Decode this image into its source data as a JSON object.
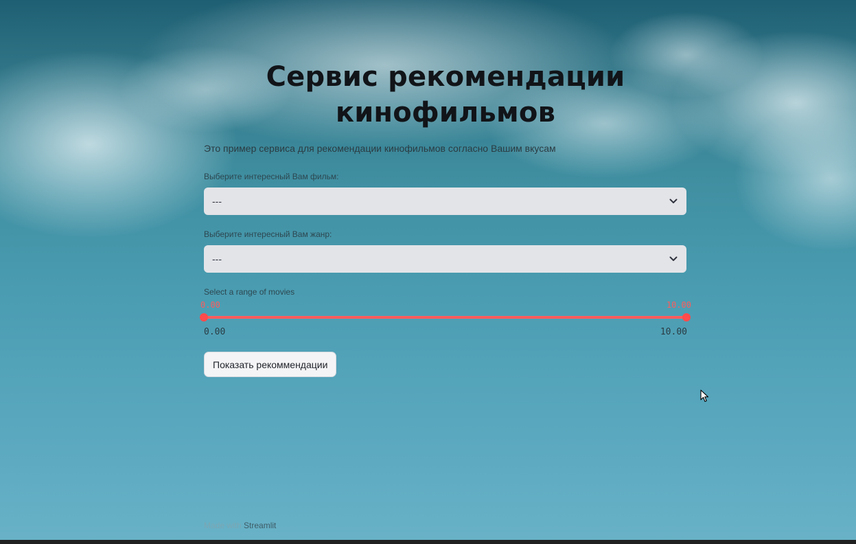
{
  "header": {
    "title_line1": "Сервис рекомендации",
    "title_line2": "кинофильмов",
    "subtitle": "Это пример сервиса для рекомендации кинофильмов согласно Вашим вкусам"
  },
  "form": {
    "film_label": "Выберите интересный Вам фильм:",
    "film_value": "---",
    "genre_label": "Выберите интересный Вам жанр:",
    "genre_value": "---",
    "range_label": "Select a range of movies",
    "range_min_value": "0.00",
    "range_max_value": "10.00",
    "range_min_tick": "0.00",
    "range_max_tick": "10.00",
    "range_selected": [
      0.0,
      10.0
    ],
    "submit_label": "Показать рекоммендации"
  },
  "footer": {
    "made_with": "Made with",
    "brand": "Streamlit"
  },
  "colors": {
    "accent": "#ff4b4b",
    "select_bg": "#e3e4e8"
  },
  "icons": [
    "chevron-down-icon",
    "mouse-cursor-icon"
  ]
}
